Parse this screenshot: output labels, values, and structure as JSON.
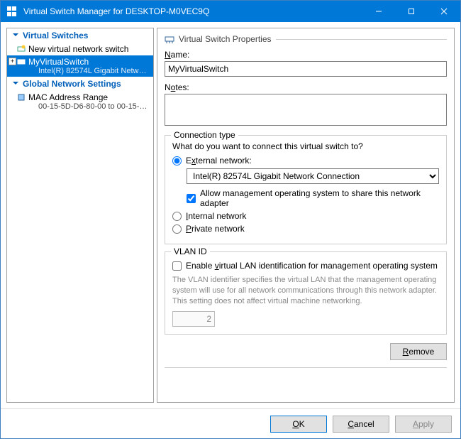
{
  "window": {
    "title": "Virtual Switch Manager for DESKTOP-M0VEC9Q",
    "minimize": "—",
    "maximize": "□",
    "close": "×"
  },
  "tree": {
    "section_vs": "Virtual Switches",
    "new_switch": "New virtual network switch",
    "selected_name": "MyVirtualSwitch",
    "selected_sub": "Intel(R) 82574L Gigabit Network C...",
    "section_global": "Global Network Settings",
    "mac_range": "MAC Address Range",
    "mac_range_sub": "00-15-5D-D6-80-00 to 00-15-5D-D..."
  },
  "props": {
    "heading": "Virtual Switch Properties",
    "name_label_pre": "N",
    "name_label_rest": "ame:",
    "name_value": "MyVirtualSwitch",
    "notes_label_pre": "N",
    "notes_label_u": "o",
    "notes_label_rest": "tes:",
    "notes_value": ""
  },
  "conn": {
    "legend": "Connection type",
    "question": "What do you want to connect this virtual switch to?",
    "ext_pre": "E",
    "ext_u": "x",
    "ext_rest": "ternal network:",
    "adapter": "Intel(R) 82574L Gigabit Network Connection",
    "allow_mgmt": "Allow management operating system to share this network adapter",
    "int_u": "I",
    "int_rest": "nternal network",
    "priv_u": "P",
    "priv_rest": "rivate network"
  },
  "vlan": {
    "legend": "VLAN ID",
    "enable_pre": "Enable ",
    "enable_u": "v",
    "enable_rest": "irtual LAN identification for management operating system",
    "help": "The VLAN identifier specifies the virtual LAN that the management operating system will use for all network communications through this network adapter. This setting does not affect virtual machine networking.",
    "value": "2"
  },
  "buttons": {
    "remove_u": "R",
    "remove_rest": "emove",
    "ok_u": "O",
    "ok_rest": "K",
    "cancel_u": "C",
    "cancel_rest": "ancel",
    "apply_u": "A",
    "apply_rest": "pply"
  }
}
